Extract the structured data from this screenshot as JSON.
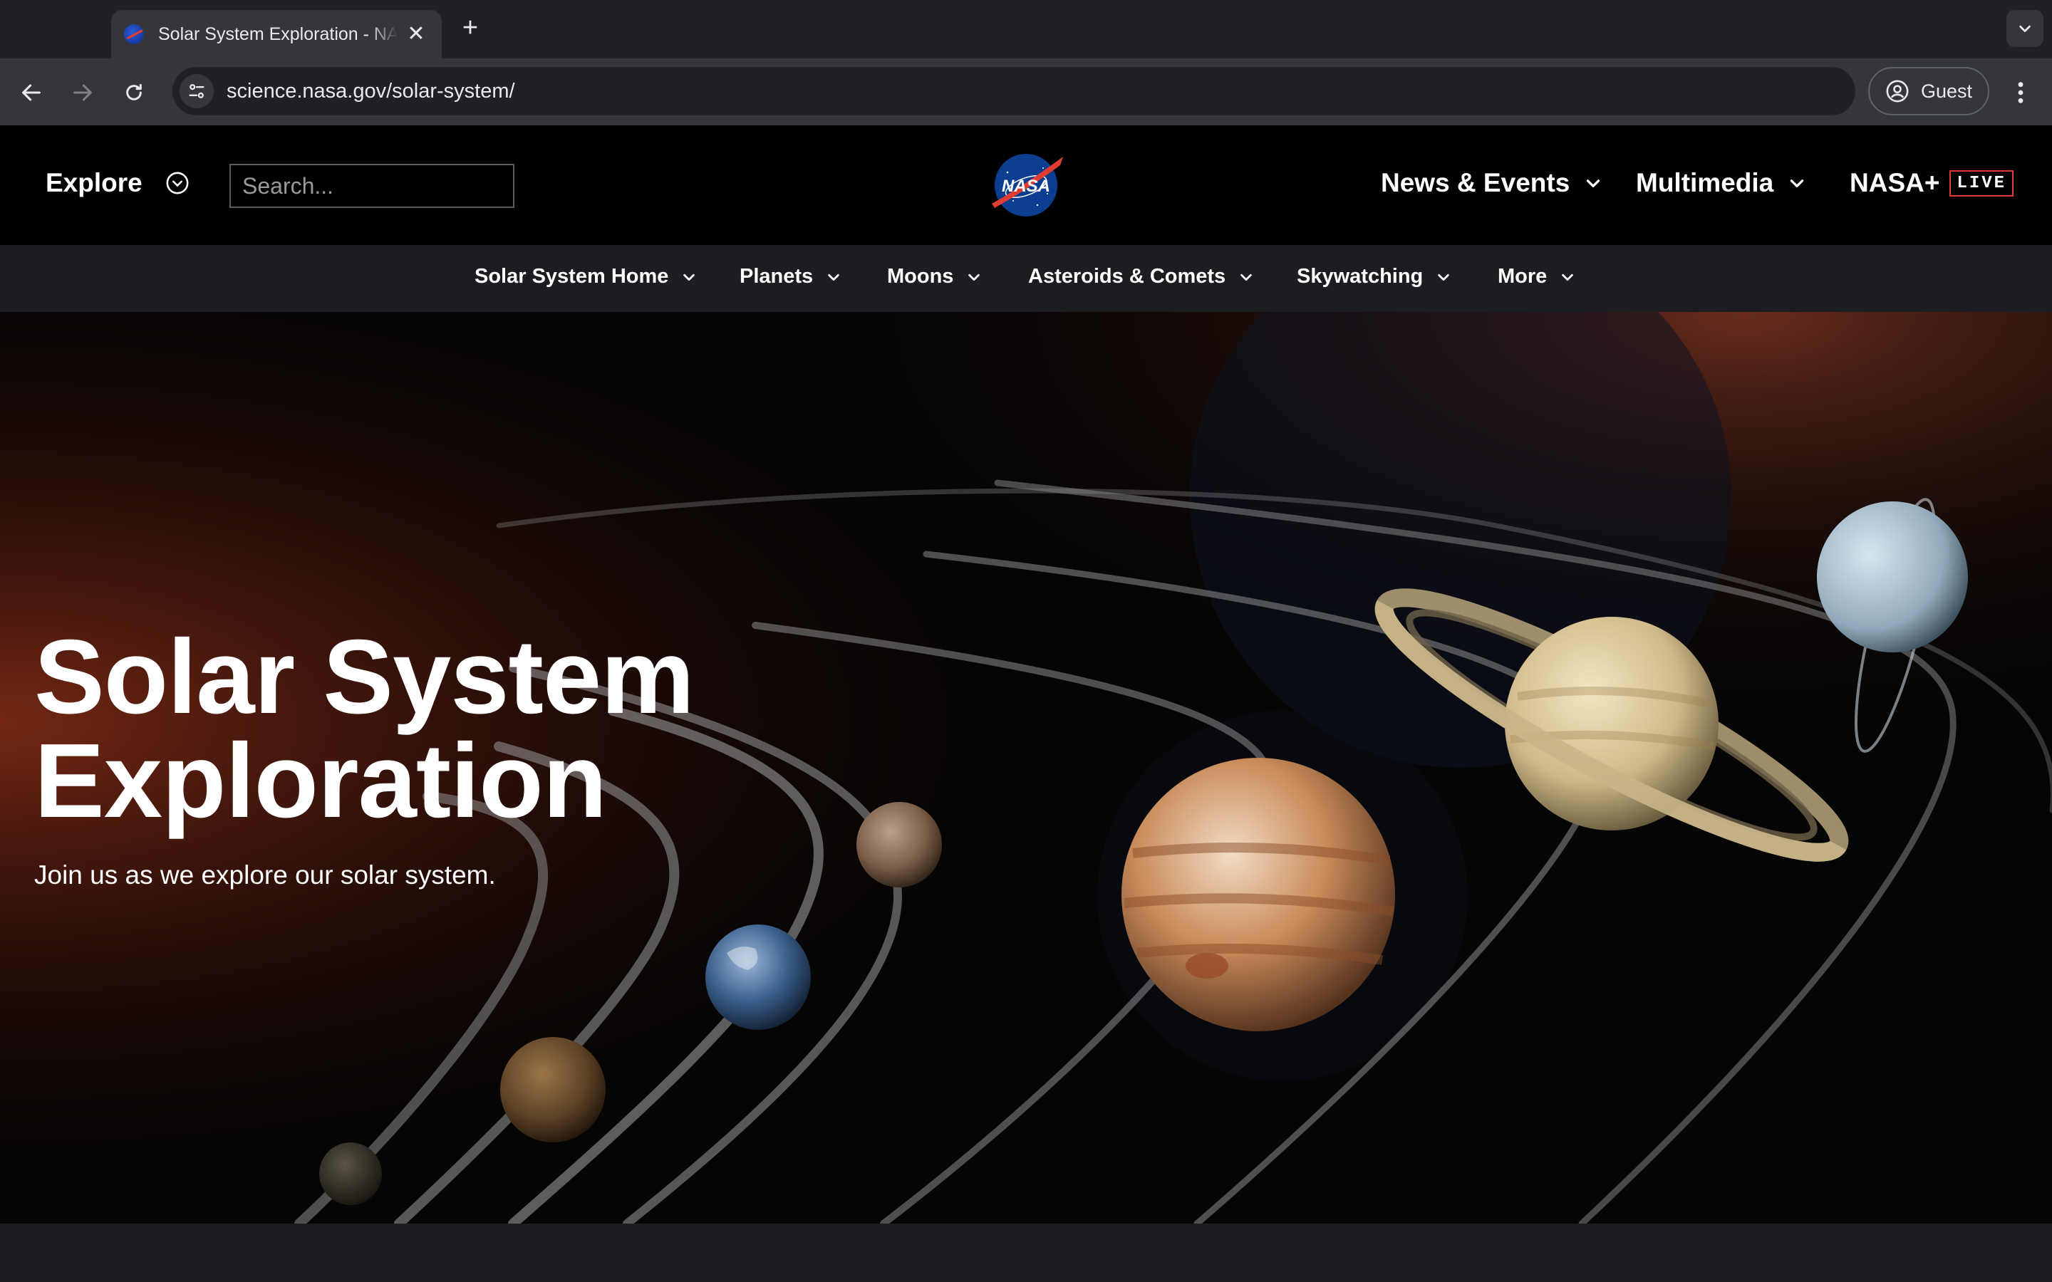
{
  "browser": {
    "tab_title": "Solar System Exploration - NASA Science",
    "url": "science.nasa.gov/solar-system/",
    "profile_label": "Guest",
    "new_tab_symbol": "+",
    "close_symbol": "✕"
  },
  "header": {
    "explore_label": "Explore",
    "search_placeholder": "Search...",
    "logo_text": "NASA",
    "nav": [
      {
        "label": "News & Events"
      },
      {
        "label": "Multimedia"
      },
      {
        "label": "NASA+",
        "badge": "LIVE"
      }
    ]
  },
  "subnav": {
    "items": [
      {
        "label": "Solar System Home"
      },
      {
        "label": "Planets"
      },
      {
        "label": "Moons"
      },
      {
        "label": "Asteroids & Comets"
      },
      {
        "label": "Skywatching"
      },
      {
        "label": "More"
      }
    ]
  },
  "hero": {
    "title_line1": "Solar System",
    "title_line2": "Exploration",
    "subtitle": "Join us as we explore our solar system."
  },
  "colors": {
    "background": "#000000",
    "subnav_bg": "#1c1d21",
    "nasa_red": "#e03c31",
    "nasa_blue": "#0b3d91"
  }
}
